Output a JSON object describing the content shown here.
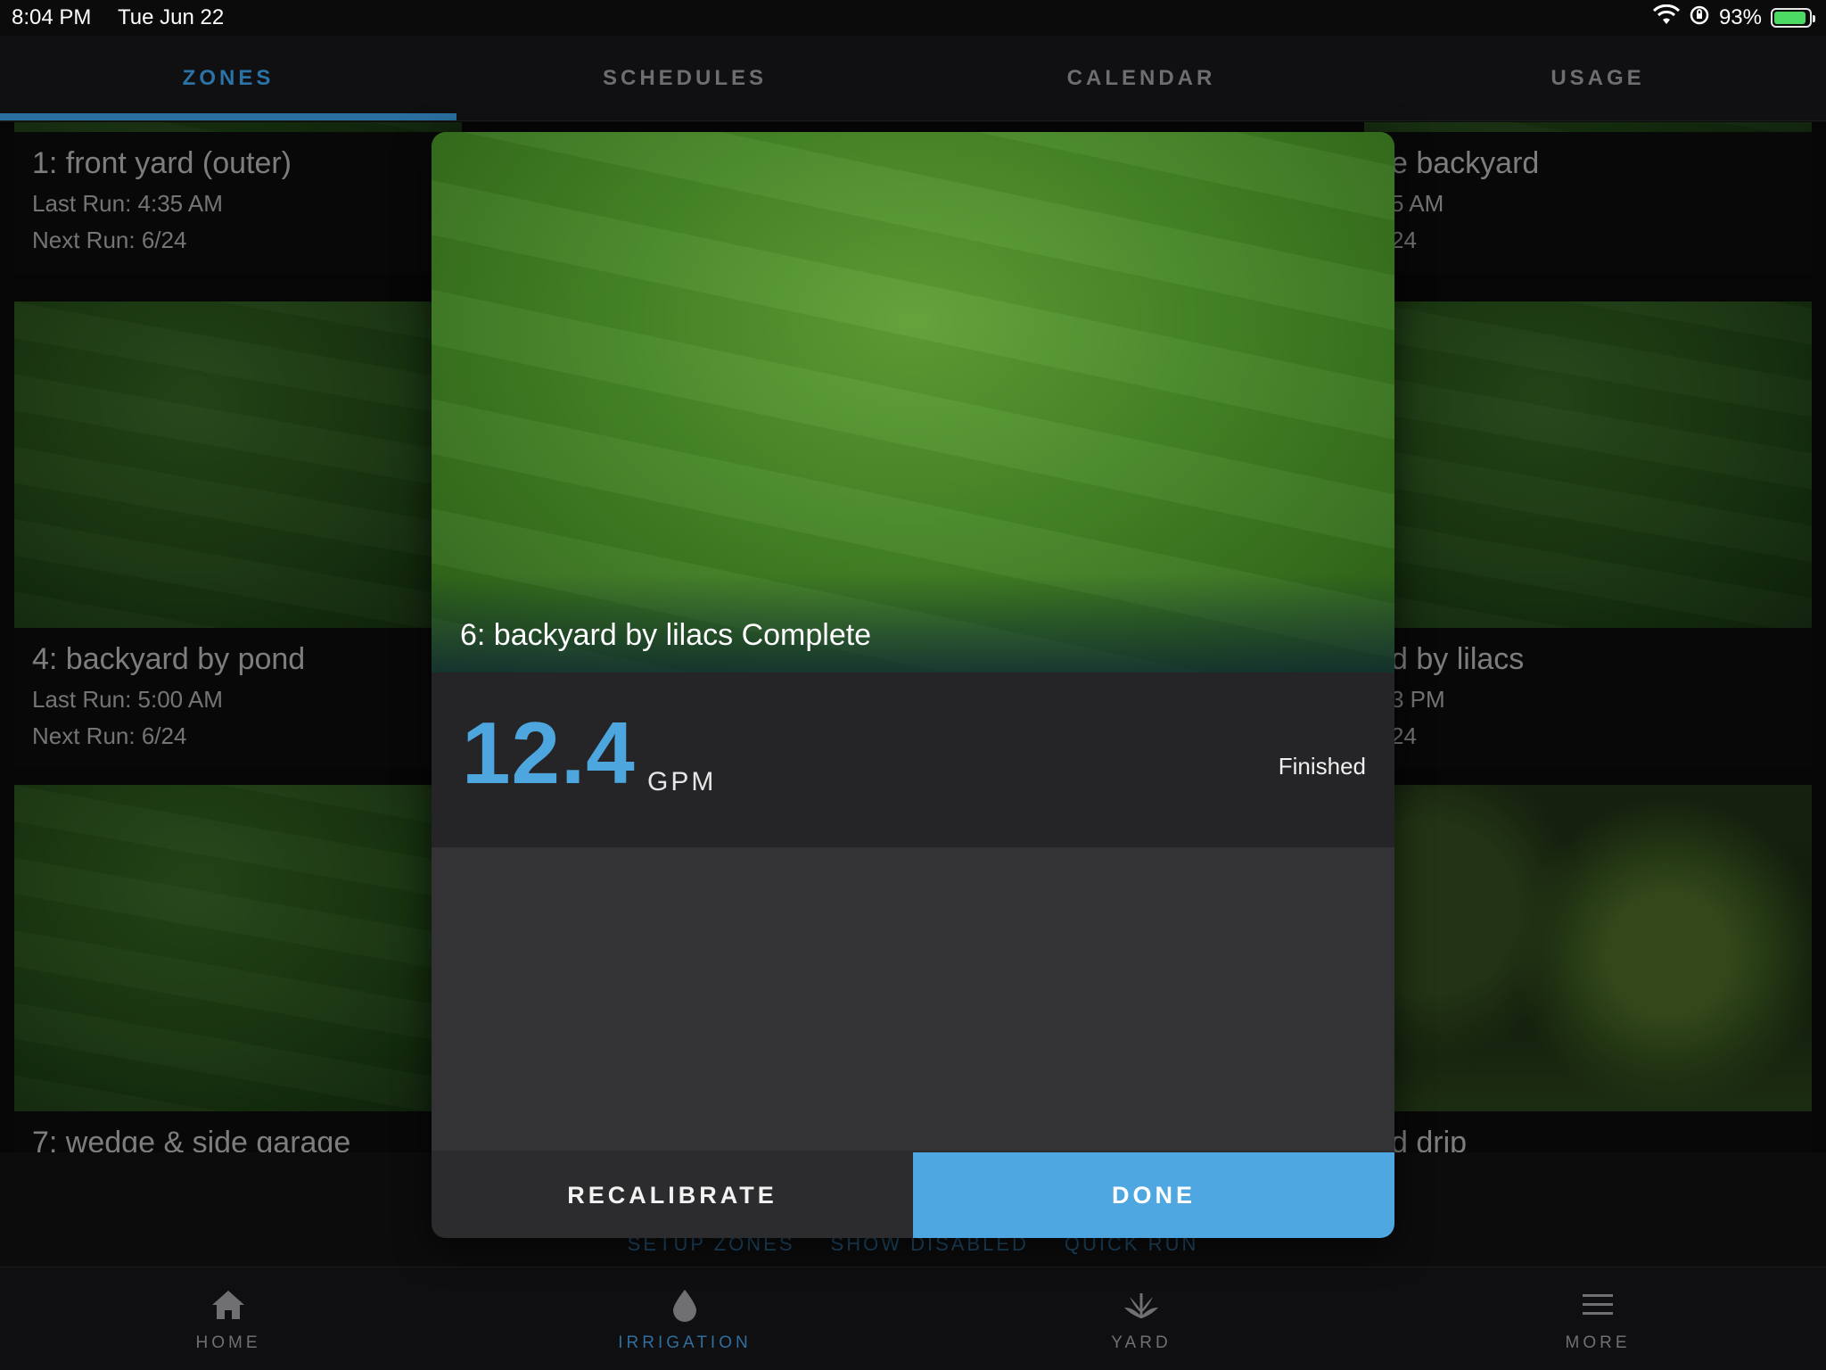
{
  "status": {
    "time": "8:04 PM",
    "date": "Tue Jun 22",
    "battery": "93%"
  },
  "top_tabs": [
    {
      "label": "ZONES",
      "active": true
    },
    {
      "label": "SCHEDULES",
      "active": false
    },
    {
      "label": "CALENDAR",
      "active": false
    },
    {
      "label": "USAGE",
      "active": false
    }
  ],
  "zones": [
    {
      "title": "1: front yard (outer)",
      "last_run": "Last Run: 4:35 AM",
      "next_run": "Next Run: 6/24"
    },
    {
      "title": "4: backyard by pond",
      "last_run": "Last Run: 5:00 AM",
      "next_run": "Next Run: 6/24"
    },
    {
      "title": "7: wedge & side garage"
    },
    {
      "title": "e backyard",
      "last_run": "5 AM",
      "next_run": "24"
    },
    {
      "title": "d by lilacs",
      "last_run": "3 PM",
      "next_run": "24"
    },
    {
      "title": "d drip"
    }
  ],
  "footer_links": [
    "SETUP ZONES",
    "SHOW DISABLED",
    "QUICK RUN"
  ],
  "bottom_tabs": [
    {
      "label": "HOME",
      "icon": "home-icon"
    },
    {
      "label": "IRRIGATION",
      "icon": "water-drop-icon",
      "active": true
    },
    {
      "label": "YARD",
      "icon": "plant-icon"
    },
    {
      "label": "MORE",
      "icon": "menu-icon"
    }
  ],
  "modal": {
    "title": "6: backyard by lilacs Complete",
    "flow_value": "12.4",
    "flow_unit": "GPM",
    "status": "Finished",
    "recalibrate_label": "RECALIBRATE",
    "done_label": "DONE"
  },
  "colors": {
    "accent": "#4ea7e0",
    "active_tab": "#2b73a6",
    "modal_bg": "#2c2c2e"
  }
}
